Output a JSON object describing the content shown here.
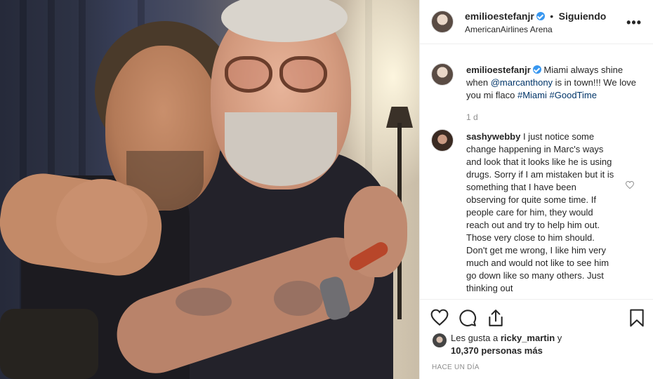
{
  "post": {
    "image_alt": "Photo of two men hugging",
    "header": {
      "username": "emilioestefanjr",
      "follow_status": "Siguiendo",
      "separator": "•",
      "location": "AmericanAirlines Arena",
      "more_icon": "more-horizontal-icon",
      "more_label": "•••"
    },
    "caption": {
      "username": "emilioestefanjr",
      "text_before": "Miami always shine when ",
      "mention": "@marcanthony",
      "text_middle": " is in town!!! We love you mi flaco ",
      "hashtag1": "#Miami",
      "hashtag2": "#GoodTime",
      "time": "1 d"
    },
    "comment": {
      "username": "sashywebby",
      "text": "I just notice some change happening in Marc's ways and look that it looks like he is using drugs. Sorry if I am mistaken but it is something that I have been observing for quite some time. If people care for him, they would reach out and try to help him out. Those very close to him should. Don't get me wrong, I like him very much and would not like to see him go down like so many others. Just thinking out"
    },
    "actions": {
      "like_icon": "heart-icon",
      "comment_icon": "comment-bubble-icon",
      "share_icon": "share-icon",
      "save_icon": "bookmark-icon"
    },
    "likes": {
      "prefix": "Les gusta a",
      "liker": "ricky_martin",
      "conjunction": "y",
      "count": "10,370 personas más"
    },
    "posted_ago": "HACE UN DÍA"
  },
  "colors": {
    "text": "#262626",
    "muted": "#8e8e8e",
    "link": "#003569",
    "verified": "#3897f0",
    "border": "#efefef"
  }
}
